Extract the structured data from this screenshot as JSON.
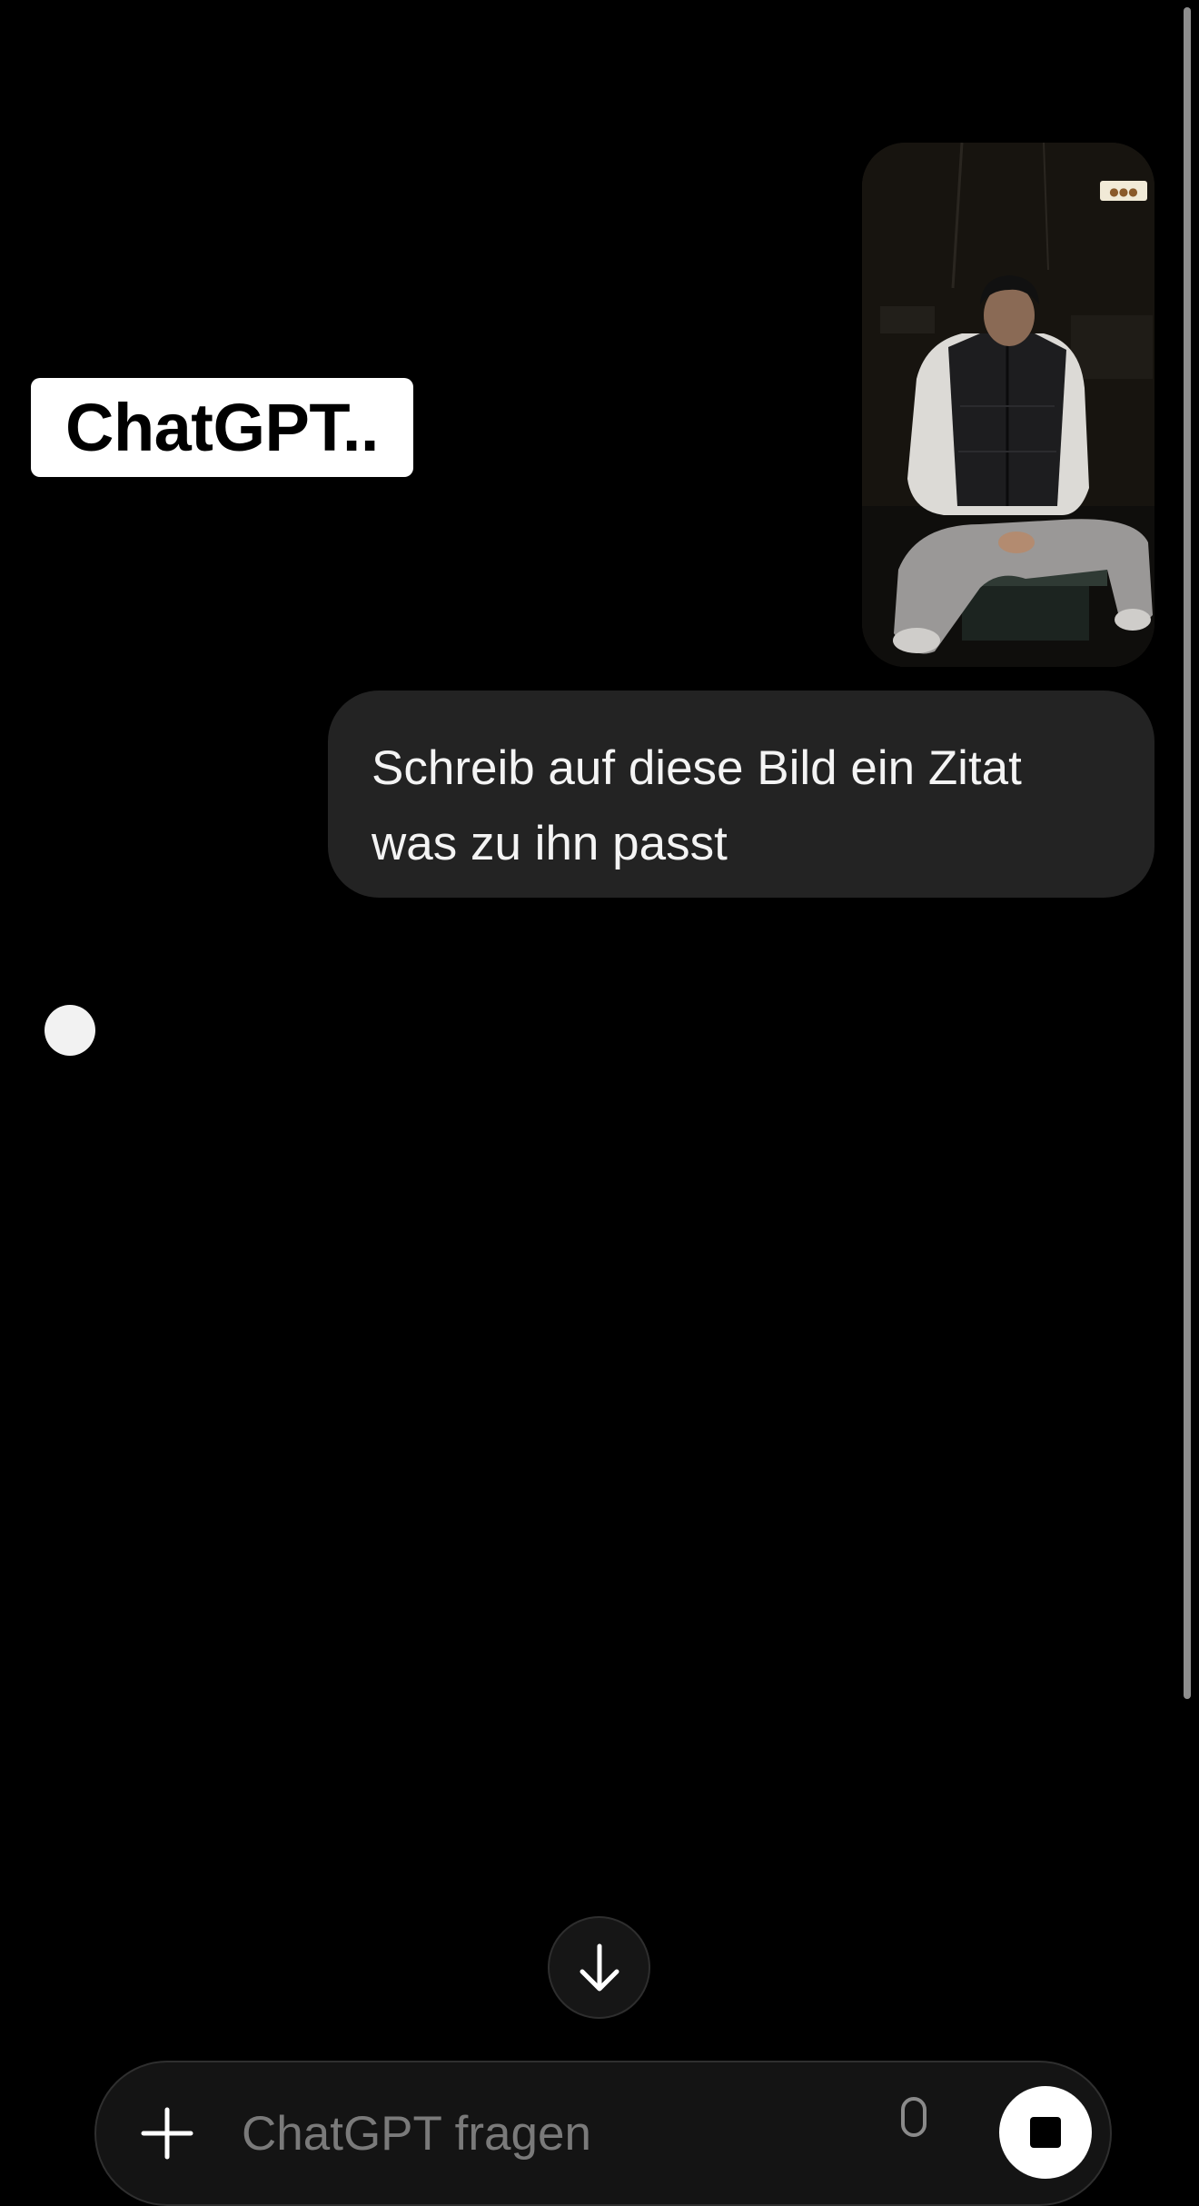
{
  "overlay": {
    "label": "ChatGPT.."
  },
  "conversation": {
    "user_image_alt": "photo-attachment",
    "user_message": "Schreib auf diese Bild ein Zitat was zu ihn passt",
    "assistant_state": "typing"
  },
  "composer": {
    "placeholder": "ChatGPT fragen",
    "value": ""
  },
  "icons": {
    "scroll_down": "arrow-down-icon",
    "add": "plus-icon",
    "voice": "microphone-icon",
    "stop": "stop-icon"
  },
  "colors": {
    "background": "#000000",
    "user_bubble": "#232323",
    "composer": "#141414",
    "label_bg": "#ffffff"
  }
}
